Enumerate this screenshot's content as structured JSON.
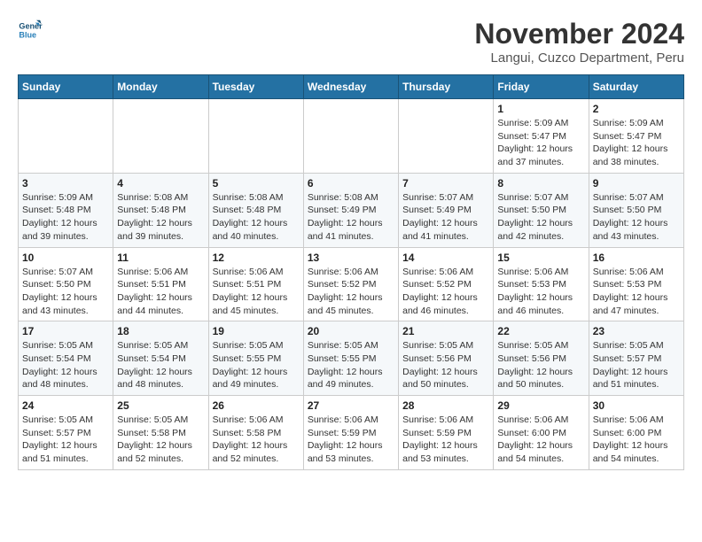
{
  "header": {
    "logo_line1": "General",
    "logo_line2": "Blue",
    "month_year": "November 2024",
    "location": "Langui, Cuzco Department, Peru"
  },
  "weekdays": [
    "Sunday",
    "Monday",
    "Tuesday",
    "Wednesday",
    "Thursday",
    "Friday",
    "Saturday"
  ],
  "weeks": [
    [
      {
        "day": "",
        "info": ""
      },
      {
        "day": "",
        "info": ""
      },
      {
        "day": "",
        "info": ""
      },
      {
        "day": "",
        "info": ""
      },
      {
        "day": "",
        "info": ""
      },
      {
        "day": "1",
        "info": "Sunrise: 5:09 AM\nSunset: 5:47 PM\nDaylight: 12 hours\nand 37 minutes."
      },
      {
        "day": "2",
        "info": "Sunrise: 5:09 AM\nSunset: 5:47 PM\nDaylight: 12 hours\nand 38 minutes."
      }
    ],
    [
      {
        "day": "3",
        "info": "Sunrise: 5:09 AM\nSunset: 5:48 PM\nDaylight: 12 hours\nand 39 minutes."
      },
      {
        "day": "4",
        "info": "Sunrise: 5:08 AM\nSunset: 5:48 PM\nDaylight: 12 hours\nand 39 minutes."
      },
      {
        "day": "5",
        "info": "Sunrise: 5:08 AM\nSunset: 5:48 PM\nDaylight: 12 hours\nand 40 minutes."
      },
      {
        "day": "6",
        "info": "Sunrise: 5:08 AM\nSunset: 5:49 PM\nDaylight: 12 hours\nand 41 minutes."
      },
      {
        "day": "7",
        "info": "Sunrise: 5:07 AM\nSunset: 5:49 PM\nDaylight: 12 hours\nand 41 minutes."
      },
      {
        "day": "8",
        "info": "Sunrise: 5:07 AM\nSunset: 5:50 PM\nDaylight: 12 hours\nand 42 minutes."
      },
      {
        "day": "9",
        "info": "Sunrise: 5:07 AM\nSunset: 5:50 PM\nDaylight: 12 hours\nand 43 minutes."
      }
    ],
    [
      {
        "day": "10",
        "info": "Sunrise: 5:07 AM\nSunset: 5:50 PM\nDaylight: 12 hours\nand 43 minutes."
      },
      {
        "day": "11",
        "info": "Sunrise: 5:06 AM\nSunset: 5:51 PM\nDaylight: 12 hours\nand 44 minutes."
      },
      {
        "day": "12",
        "info": "Sunrise: 5:06 AM\nSunset: 5:51 PM\nDaylight: 12 hours\nand 45 minutes."
      },
      {
        "day": "13",
        "info": "Sunrise: 5:06 AM\nSunset: 5:52 PM\nDaylight: 12 hours\nand 45 minutes."
      },
      {
        "day": "14",
        "info": "Sunrise: 5:06 AM\nSunset: 5:52 PM\nDaylight: 12 hours\nand 46 minutes."
      },
      {
        "day": "15",
        "info": "Sunrise: 5:06 AM\nSunset: 5:53 PM\nDaylight: 12 hours\nand 46 minutes."
      },
      {
        "day": "16",
        "info": "Sunrise: 5:06 AM\nSunset: 5:53 PM\nDaylight: 12 hours\nand 47 minutes."
      }
    ],
    [
      {
        "day": "17",
        "info": "Sunrise: 5:05 AM\nSunset: 5:54 PM\nDaylight: 12 hours\nand 48 minutes."
      },
      {
        "day": "18",
        "info": "Sunrise: 5:05 AM\nSunset: 5:54 PM\nDaylight: 12 hours\nand 48 minutes."
      },
      {
        "day": "19",
        "info": "Sunrise: 5:05 AM\nSunset: 5:55 PM\nDaylight: 12 hours\nand 49 minutes."
      },
      {
        "day": "20",
        "info": "Sunrise: 5:05 AM\nSunset: 5:55 PM\nDaylight: 12 hours\nand 49 minutes."
      },
      {
        "day": "21",
        "info": "Sunrise: 5:05 AM\nSunset: 5:56 PM\nDaylight: 12 hours\nand 50 minutes."
      },
      {
        "day": "22",
        "info": "Sunrise: 5:05 AM\nSunset: 5:56 PM\nDaylight: 12 hours\nand 50 minutes."
      },
      {
        "day": "23",
        "info": "Sunrise: 5:05 AM\nSunset: 5:57 PM\nDaylight: 12 hours\nand 51 minutes."
      }
    ],
    [
      {
        "day": "24",
        "info": "Sunrise: 5:05 AM\nSunset: 5:57 PM\nDaylight: 12 hours\nand 51 minutes."
      },
      {
        "day": "25",
        "info": "Sunrise: 5:05 AM\nSunset: 5:58 PM\nDaylight: 12 hours\nand 52 minutes."
      },
      {
        "day": "26",
        "info": "Sunrise: 5:06 AM\nSunset: 5:58 PM\nDaylight: 12 hours\nand 52 minutes."
      },
      {
        "day": "27",
        "info": "Sunrise: 5:06 AM\nSunset: 5:59 PM\nDaylight: 12 hours\nand 53 minutes."
      },
      {
        "day": "28",
        "info": "Sunrise: 5:06 AM\nSunset: 5:59 PM\nDaylight: 12 hours\nand 53 minutes."
      },
      {
        "day": "29",
        "info": "Sunrise: 5:06 AM\nSunset: 6:00 PM\nDaylight: 12 hours\nand 54 minutes."
      },
      {
        "day": "30",
        "info": "Sunrise: 5:06 AM\nSunset: 6:00 PM\nDaylight: 12 hours\nand 54 minutes."
      }
    ]
  ]
}
